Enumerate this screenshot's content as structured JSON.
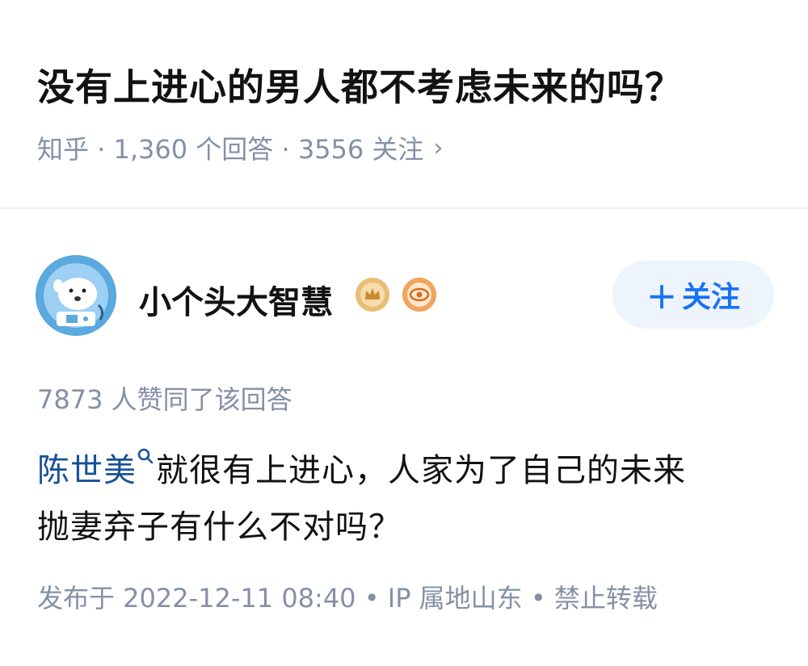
{
  "question": {
    "title": "没有上进心的男人都不考虑未来的吗？",
    "meta": "知乎 · 1,360 个回答 · 3556 关注",
    "chevron": "›"
  },
  "author": {
    "name": "小个头大智慧",
    "avatar_icon": "astronaut-polar-bear-avatar",
    "badges": [
      "crown-badge-icon",
      "eye-badge-icon"
    ],
    "follow_label": "关注",
    "follow_plus": "＋"
  },
  "answer": {
    "likes_text": "7873 人赞同了该回答",
    "link_text": "陈世美",
    "body_line1_rest": "就很有上进心，人家为了自己的未来",
    "body_line2": "抛妻弃子有什么不对吗？",
    "publish_info": "发布于 2022-12-11 08:40 • IP 属地山东 • 禁止转载"
  },
  "colors": {
    "title": "#121212",
    "meta": "#8590a6",
    "link": "#175199",
    "follow_text": "#1772f6",
    "follow_bg": "#eef4fb"
  }
}
